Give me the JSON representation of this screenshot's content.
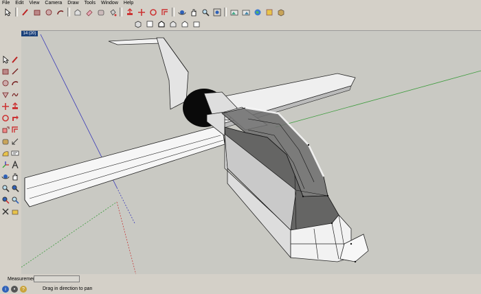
{
  "menu": {
    "file": "File",
    "edit": "Edit",
    "view": "View",
    "camera": "Camera",
    "draw": "Draw",
    "tools": "Tools",
    "window": "Window",
    "help": "Help"
  },
  "scene_tab": "14 (20)",
  "measurements": {
    "label": "Measurements",
    "value": ""
  },
  "status": {
    "text": "Drag in direction to pan",
    "icons": [
      "info-icon",
      "credit-icon",
      "help-icon"
    ]
  },
  "colors": {
    "ui_background": "#d4d0c8",
    "viewport_background": "#c9c9c3",
    "red_axis": "#c53b3b",
    "green_axis": "#3a9b3a",
    "blue_axis": "#3535b8",
    "selection": "#555555",
    "scene_tab": "#19407a"
  },
  "toolbar_icons": {
    "main": [
      "select-icon",
      "pencil-icon",
      "rectangle-icon",
      "circle-icon",
      "arc-icon",
      "make-component-icon",
      "eraser-icon",
      "tape-measure-icon",
      "paint-bucket-icon",
      "push-pull-icon",
      "move-icon",
      "rotate-icon",
      "offset-icon",
      "orbit-icon",
      "pan-icon",
      "zoom-icon",
      "zoom-extents-icon",
      "previous-view-icon",
      "next-view-icon",
      "google-earth-icon",
      "add-location-icon",
      "components-icon"
    ],
    "views": [
      "iso-view-icon",
      "top-view-icon",
      "front-view-icon",
      "right-view-icon",
      "back-view-icon",
      "left-view-icon"
    ],
    "left": [
      "select-icon",
      "pencil-icon",
      "rectangle-icon",
      "line-icon",
      "circle-icon",
      "arc-icon",
      "polygon-icon",
      "freehand-icon",
      "move-icon",
      "push-pull-icon",
      "rotate-icon",
      "follow-me-icon",
      "scale-icon",
      "offset-icon",
      "tape-measure-icon",
      "dimension-icon",
      "protractor-icon",
      "text-icon",
      "axes-icon",
      "3d-text-icon",
      "orbit-icon",
      "pan-icon",
      "zoom-icon",
      "zoom-window-icon",
      "walk-icon",
      "look-around-icon",
      "position-camera-icon",
      "section-plane-icon"
    ]
  }
}
